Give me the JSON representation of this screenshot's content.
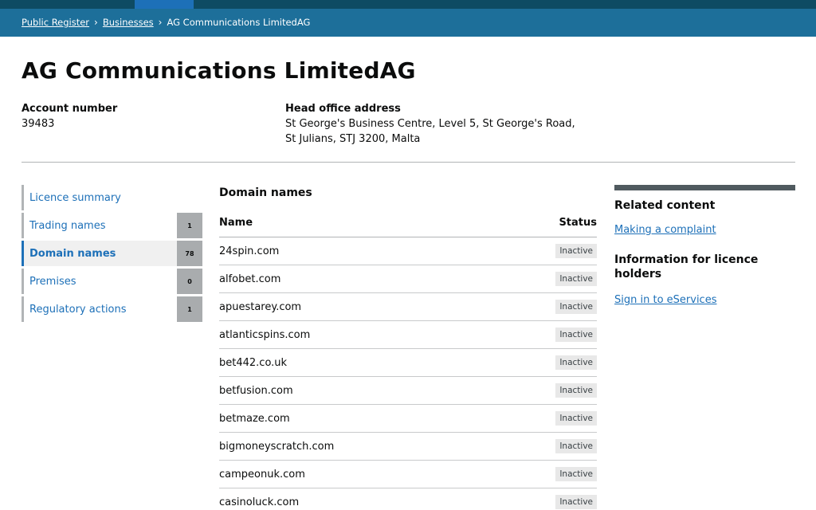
{
  "breadcrumb": {
    "items": [
      "Public Register",
      "Businesses"
    ],
    "current": "AG Communications LimitedAG",
    "separator": "›"
  },
  "page_title": "AG Communications LimitedAG",
  "account": {
    "label": "Account number",
    "value": "39483"
  },
  "head_office": {
    "label": "Head office address",
    "lines": [
      "St George's Business Centre, Level 5, St George's Road,",
      "St Julians, STJ 3200, Malta"
    ]
  },
  "sidenav": {
    "items": [
      {
        "label": "Licence summary",
        "count": null
      },
      {
        "label": "Trading names",
        "count": "1"
      },
      {
        "label": "Domain names",
        "count": "78"
      },
      {
        "label": "Premises",
        "count": "0"
      },
      {
        "label": "Regulatory actions",
        "count": "1"
      }
    ],
    "active_index": 2
  },
  "domains": {
    "heading": "Domain names",
    "columns": {
      "name": "Name",
      "status": "Status"
    },
    "rows": [
      {
        "name": "24spin.com",
        "status": "Inactive"
      },
      {
        "name": "alfobet.com",
        "status": "Inactive"
      },
      {
        "name": "apuestarey.com",
        "status": "Inactive"
      },
      {
        "name": "atlanticspins.com",
        "status": "Inactive"
      },
      {
        "name": "bet442.co.uk",
        "status": "Inactive"
      },
      {
        "name": "betfusion.com",
        "status": "Inactive"
      },
      {
        "name": "betmaze.com",
        "status": "Inactive"
      },
      {
        "name": "bigmoneyscratch.com",
        "status": "Inactive"
      },
      {
        "name": "campeonuk.com",
        "status": "Inactive"
      },
      {
        "name": "casinoluck.com",
        "status": "Inactive"
      }
    ]
  },
  "related": {
    "heading": "Related content",
    "link1": "Making a complaint",
    "heading2": "Information for licence holders",
    "link2": "Sign in to eServices"
  },
  "colors": {
    "header_dark": "#0e4b63",
    "header_blue": "#1d6f9a",
    "link_blue": "#1d70b8",
    "count_badge": "#a9acae",
    "status_tag": "#e8e8e8"
  }
}
